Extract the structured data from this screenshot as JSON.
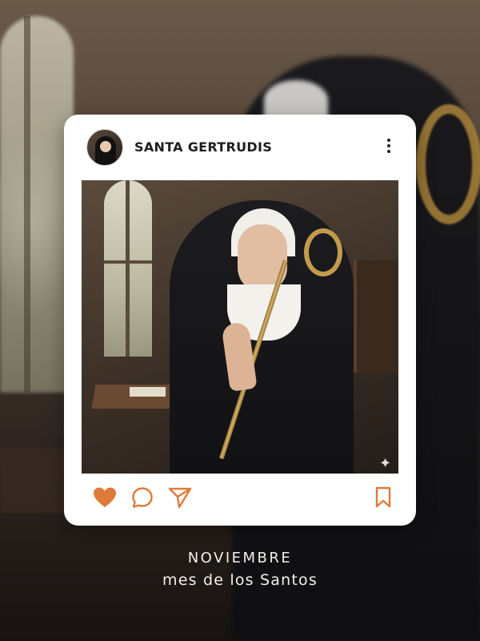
{
  "post": {
    "username": "SANTA GERTRUDIS",
    "avatar_icon": "nun-portrait-avatar",
    "more_icon": "more-vertical-icon",
    "image_icon": "praying-nun-with-crozier-photo",
    "sparkle_icon": "sparkle-icon",
    "actions": {
      "like_icon": "heart-icon",
      "comment_icon": "comment-icon",
      "share_icon": "send-icon",
      "save_icon": "bookmark-icon"
    }
  },
  "caption": {
    "line1": "NOVIEMBRE",
    "line2": "mes de los Santos"
  },
  "colors": {
    "accent": "#e07a3a",
    "card": "#ffffff",
    "caption_text": "#f3efe9"
  }
}
